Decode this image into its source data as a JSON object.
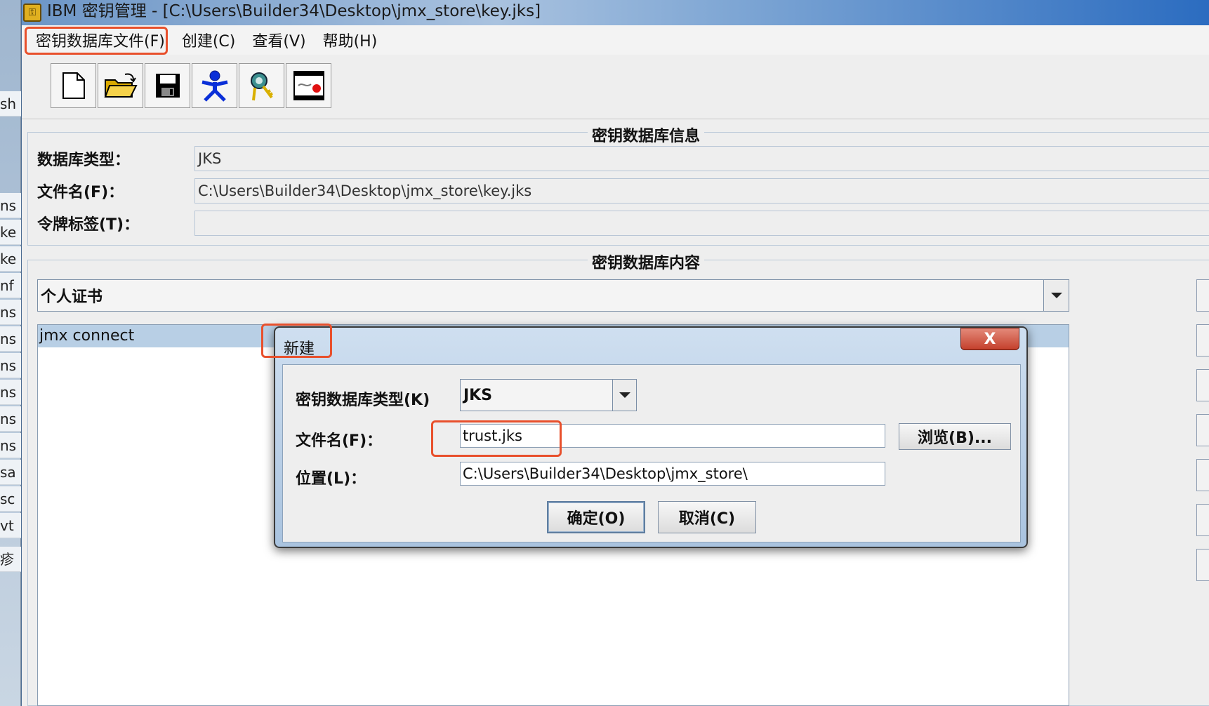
{
  "window": {
    "title": "IBM 密钥管理 - [C:\\Users\\Builder34\\Desktop\\jmx_store\\key.jks]"
  },
  "background_fragments": [
    "sh",
    "ns",
    "ke",
    "ke",
    "nf",
    "ns",
    "ns",
    "ns",
    "ns",
    "ns",
    "ns",
    "sa",
    "sc",
    "vt",
    "疹"
  ],
  "menu": {
    "items": [
      "密钥数据库文件(F)",
      "创建(C)",
      "查看(V)",
      "帮助(H)"
    ]
  },
  "toolbar": {
    "icons": [
      "new-file-icon",
      "open-folder-icon",
      "save-disk-icon",
      "person-icon",
      "key-ring-icon",
      "certificate-icon"
    ]
  },
  "db_info": {
    "title": "密钥数据库信息",
    "type_label": "数据库类型：",
    "type_value": "JKS",
    "file_label": "文件名(F)：",
    "file_value": "C:\\Users\\Builder34\\Desktop\\jmx_store\\key.jks",
    "token_label": "令牌标签(T)：",
    "token_value": ""
  },
  "db_content": {
    "title": "密钥数据库内容",
    "category_selected": "个人证书",
    "list_items": [
      "jmx connect"
    ]
  },
  "dialog": {
    "title": "新建",
    "close_label": "X",
    "type_label": "密钥数据库类型(K)",
    "type_value": "JKS",
    "file_label": "文件名(F)：",
    "file_value": "trust.jks",
    "browse_label": "浏览(B)...",
    "location_label": "位置(L)：",
    "location_value": "C:\\Users\\Builder34\\Desktop\\jmx_store\\",
    "ok_label": "确定(O)",
    "cancel_label": "取消(C)"
  },
  "colors": {
    "annotation": "#e8502c",
    "selection": "#b8cfe5"
  }
}
